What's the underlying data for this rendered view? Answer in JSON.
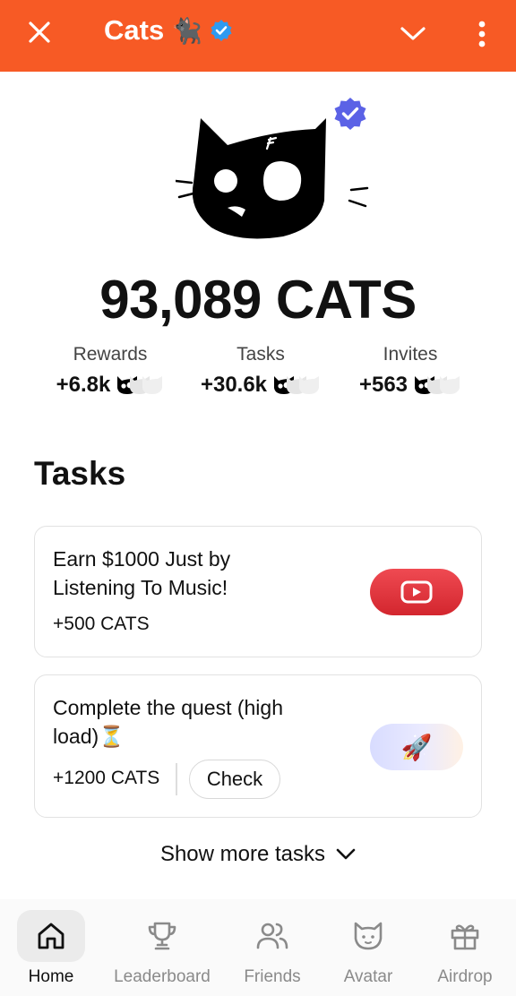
{
  "header": {
    "title": "Cats",
    "title_emoji": "🐈‍⬛",
    "brand_color": "#f75a25"
  },
  "balance": {
    "display": "93,089 CATS"
  },
  "stats": [
    {
      "label": "Rewards",
      "value": "+6.8k"
    },
    {
      "label": "Tasks",
      "value": "+30.6k"
    },
    {
      "label": "Invites",
      "value": "+563"
    }
  ],
  "tasks": {
    "title": "Tasks",
    "items": [
      {
        "title_line1": "Earn $1000 Just by",
        "title_line2": "Listening To Music!",
        "reward": "+500 CATS",
        "icon": "youtube-icon"
      },
      {
        "title_line1": "Complete the quest (high",
        "title_line2": "load)⏳",
        "reward": "+1200 CATS",
        "check_label": "Check",
        "icon": "rocket-icon"
      }
    ],
    "show_more": "Show more tasks"
  },
  "nav": {
    "items": [
      {
        "label": "Home",
        "icon": "home-icon",
        "active": true
      },
      {
        "label": "Leaderboard",
        "icon": "trophy-icon",
        "active": false
      },
      {
        "label": "Friends",
        "icon": "friends-icon",
        "active": false
      },
      {
        "label": "Avatar",
        "icon": "cat-face-icon",
        "active": false
      },
      {
        "label": "Airdrop",
        "icon": "gift-icon",
        "active": false
      }
    ]
  }
}
